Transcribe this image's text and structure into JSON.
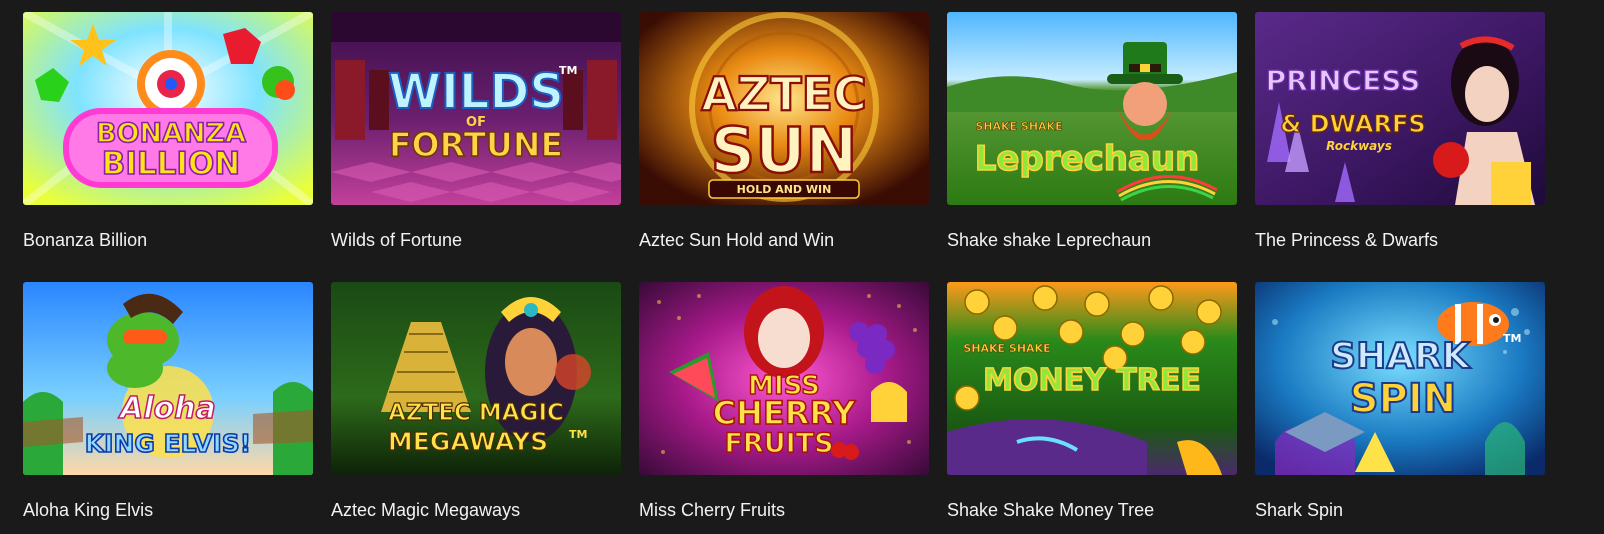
{
  "games": [
    {
      "title": "Bonanza Billion",
      "logo_lines": [
        "BONANZA",
        "BILLION"
      ]
    },
    {
      "title": "Wilds of Fortune",
      "logo_lines": [
        "WILDS",
        "OF",
        "FORTUNE"
      ],
      "logo_mark": "TM"
    },
    {
      "title": "Aztec Sun Hold and Win",
      "logo_lines": [
        "AZTEC",
        "SUN"
      ],
      "logo_sub": "HOLD AND WIN"
    },
    {
      "title": "Shake shake Leprechaun",
      "logo_small": "SHAKE SHAKE",
      "logo_lines": [
        "Leprechaun"
      ]
    },
    {
      "title": "The Princess & Dwarfs",
      "logo_lines": [
        "PRINCESS",
        "& DWARFS"
      ],
      "logo_sub": "Rockways"
    },
    {
      "title": "Aloha King Elvis",
      "logo_lines": [
        "Aloha",
        "KING ELVIS!"
      ]
    },
    {
      "title": "Aztec Magic Megaways",
      "logo_lines": [
        "AZTEC MAGIC",
        "MEGAWAYS"
      ],
      "logo_mark": "TM"
    },
    {
      "title": "Miss Cherry Fruits",
      "logo_lines": [
        "MISS",
        "CHERRY",
        "FRUITS"
      ]
    },
    {
      "title": "Shake Shake Money Tree",
      "logo_small": "SHAKE SHAKE",
      "logo_lines": [
        "MONEY TREE"
      ]
    },
    {
      "title": "Shark Spin",
      "logo_lines": [
        "SHARK",
        "SPIN"
      ],
      "logo_mark": "TM"
    }
  ],
  "colors": {
    "page_background": "#1a1a1a",
    "title_text": "#f2f2f2"
  }
}
